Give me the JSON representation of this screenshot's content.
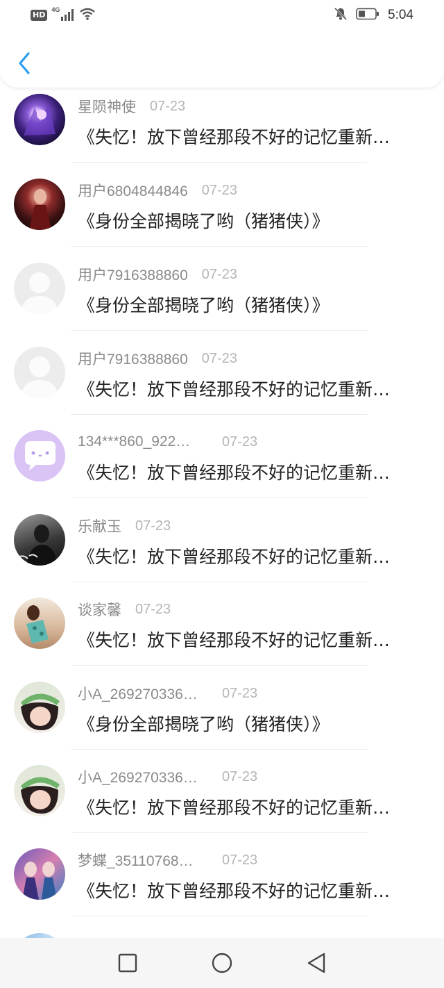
{
  "status_bar": {
    "network_badge": "HD",
    "network_type": "4G",
    "time": "5:04",
    "icons": [
      "signal-icon",
      "wifi-icon",
      "mute-bell-icon",
      "battery-icon"
    ]
  },
  "header": {
    "back_icon": "chevron-left-icon",
    "accent_color": "#2a9ef0"
  },
  "messages": [
    {
      "user": "星陨神使",
      "date": "07-23",
      "text": "《失忆！放下曾经那段不好的记忆重新…",
      "avatar": "anime-avatar-purple"
    },
    {
      "user": "用户6804844846",
      "date": "07-23",
      "text": "《身份全部揭晓了哟（猪猪侠）》",
      "avatar": "photo-avatar-red"
    },
    {
      "user": "用户7916388860",
      "date": "07-23",
      "text": "《身份全部揭晓了哟（猪猪侠）》",
      "avatar": "default-avatar"
    },
    {
      "user": "用户7916388860",
      "date": "07-23",
      "text": "《失忆！放下曾经那段不好的记忆重新…",
      "avatar": "default-avatar"
    },
    {
      "user": "134***860_922…",
      "date": "07-23",
      "text": "《失忆！放下曾经那段不好的记忆重新…",
      "avatar": "chat-bubble-avatar"
    },
    {
      "user": "乐献玉",
      "date": "07-23",
      "text": "《失忆！放下曾经那段不好的记忆重新…",
      "avatar": "photo-avatar-dark"
    },
    {
      "user": "谈家馨",
      "date": "07-23",
      "text": "《失忆！放下曾经那段不好的记忆重新…",
      "avatar": "photo-avatar-girl"
    },
    {
      "user": "小A_269270336…",
      "date": "07-23",
      "text": "《身份全部揭晓了哟（猪猪侠）》",
      "avatar": "photo-avatar-girl-green"
    },
    {
      "user": "小A_269270336…",
      "date": "07-23",
      "text": "《失忆！放下曾经那段不好的记忆重新…",
      "avatar": "photo-avatar-girl-green"
    },
    {
      "user": "梦蝶_35110768…",
      "date": "07-23",
      "text": "《失忆！放下曾经那段不好的记忆重新…",
      "avatar": "anime-avatar-group"
    }
  ],
  "nav_bar": {
    "recent_icon": "square-icon",
    "home_icon": "circle-icon",
    "back_icon": "triangle-back-icon"
  }
}
